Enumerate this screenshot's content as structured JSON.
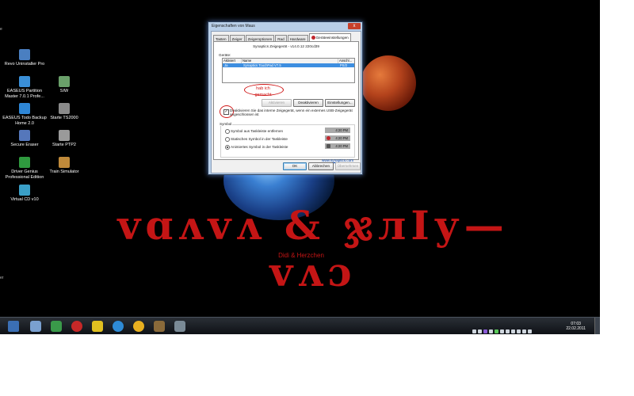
{
  "desktop": {
    "icons": [
      {
        "label": "Revo Uninstaller Pro",
        "icon": "uninstaller-icon",
        "color": "#4a7fc1"
      },
      {
        "label": "EASEUS Partition Master 7.0.1 Profe...",
        "icon": "partition-icon",
        "color": "#3a8fd8"
      },
      {
        "label": "SIW",
        "icon": "siw-icon",
        "color": "#6aa06a"
      },
      {
        "label": "EASEUS Todo Backup Home 2.0",
        "icon": "backup-icon",
        "color": "#2e86d6"
      },
      {
        "label": "Starte TS2000",
        "icon": "ts2000-icon",
        "color": "#8a8a8a"
      },
      {
        "label": "Secure Eraser",
        "icon": "eraser-icon",
        "color": "#5577bb"
      },
      {
        "label": "Starte PTP2",
        "icon": "ptp2-icon",
        "color": "#9a9a9a"
      },
      {
        "label": "Driver Genius Professional Edition",
        "icon": "driver-icon",
        "color": "#2f9a3f"
      },
      {
        "label": "Train Simulator",
        "icon": "train-icon",
        "color": "#c08a3a"
      },
      {
        "label": "Virtual CD v10",
        "icon": "cd-icon",
        "color": "#3aa0c8"
      }
    ],
    "edge_left_top": "e",
    "edge_left_bottom": "er",
    "wallpaper": {
      "big_title": "ᴠɑʌᴠʌ & ჯлІу—ᴠʌɔ",
      "subtitle": "Didi & Herzchen"
    }
  },
  "dialog": {
    "title": "Eigenschaften von Maus",
    "close_glyph": "x",
    "tabs": [
      "Tasten",
      "Zeiger",
      "Zeigeroptionen",
      "Rad",
      "Hardware",
      "Geräteeinstellungen"
    ],
    "active_tab": 5,
    "version": "Synaptics Zeigegerät - v14.0.12 220cd39",
    "devices_label": "Geräte:",
    "table": {
      "headers": [
        "Aktiviert",
        "Name",
        "Anschl..."
      ],
      "row": {
        "enabled": "Ja",
        "name": "Synaptics TouchPad V7.5",
        "port": "PS/2"
      }
    },
    "annotation": "hab ich gemacht",
    "buttons": {
      "activate": "Aktivieren",
      "deactivate": "Deaktivieren",
      "settings": "Einstellungen..."
    },
    "checkbox": {
      "checked": true,
      "mark": "✓",
      "label": "Deaktivieren Sie das interne Zeigegerät, wenn ein externes USB-Zeigegerät angeschlossen ist"
    },
    "symbol_group": {
      "title": "Symbol",
      "options": [
        {
          "label": "Symbol aus Taskleiste entfernen",
          "selected": false,
          "time": "4:20 PM"
        },
        {
          "label": "Statisches Symbol in der Taskleiste",
          "selected": false,
          "time": "4:20 PM"
        },
        {
          "label": "Animiertes Symbol in der Taskleiste",
          "selected": true,
          "time": "4:20 PM"
        }
      ]
    },
    "link": "www.synaptics.com",
    "footer": {
      "ok": "OK",
      "cancel": "Abbrechen",
      "apply": "Übernehmen"
    }
  },
  "taskbar": {
    "apps": [
      {
        "icon": "media-player-icon",
        "color": "#3f7fd0"
      },
      {
        "icon": "network-printer-icon",
        "color": "#7aa0d0"
      },
      {
        "icon": "spreadsheet-icon",
        "color": "#3a9a4a"
      },
      {
        "icon": "opera-browser-icon",
        "color": "#c62828"
      },
      {
        "icon": "pinwheel-icon",
        "color": "#e0c020"
      },
      {
        "icon": "globe-icon",
        "color": "#2e8bd6"
      },
      {
        "icon": "chrome-browser-icon",
        "color": "#e8b020"
      },
      {
        "icon": "game-icon",
        "color": "#8a6a3a"
      },
      {
        "icon": "alien-icon",
        "color": "#7a8a96"
      }
    ],
    "clock": {
      "time": "07:03",
      "date": "22.02.2011"
    }
  }
}
